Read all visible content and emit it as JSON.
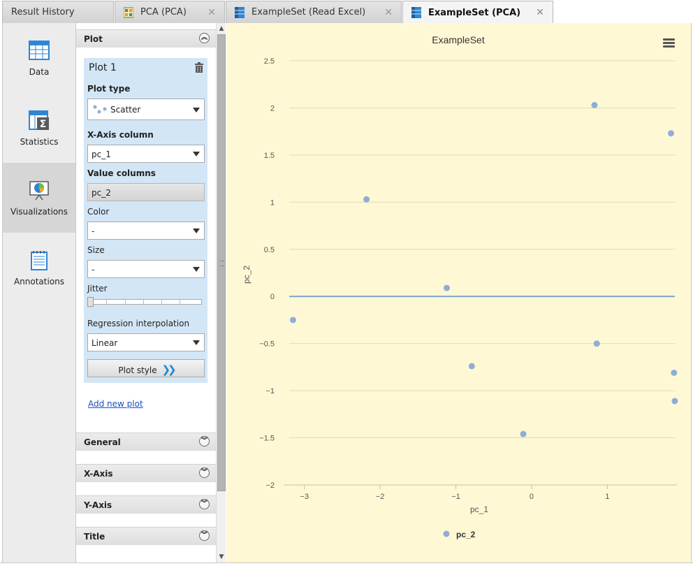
{
  "tabs": [
    {
      "label": "Result History",
      "icon": "",
      "closable": false
    },
    {
      "label": "PCA (PCA)",
      "icon": "pca-model-icon",
      "closable": true
    },
    {
      "label": "ExampleSet (Read Excel)",
      "icon": "exampleset-icon",
      "closable": true
    },
    {
      "label": "ExampleSet (PCA)",
      "icon": "exampleset-icon",
      "closable": true,
      "active": true
    }
  ],
  "close_glyph": "✕",
  "leftnav": {
    "items": [
      {
        "label": "Data",
        "icon": "data-table-icon"
      },
      {
        "label": "Statistics",
        "icon": "statistics-icon"
      },
      {
        "label": "Visualizations",
        "icon": "visualizations-icon",
        "active": true
      },
      {
        "label": "Annotations",
        "icon": "annotations-icon"
      }
    ]
  },
  "config": {
    "plot_section": "Plot",
    "plot": {
      "title": "Plot 1",
      "plot_type_label": "Plot type",
      "plot_type_value": "Scatter",
      "x_axis_label": "X-Axis column",
      "x_axis_value": "pc_1",
      "value_columns_label": "Value columns",
      "value_columns_value": "pc_2",
      "color_label": "Color",
      "color_value": "-",
      "size_label": "Size",
      "size_value": "-",
      "jitter_label": "Jitter",
      "regression_label": "Regression interpolation",
      "regression_value": "Linear",
      "plot_style_button": "Plot style"
    },
    "add_new_plot": "Add new plot",
    "sections": [
      "General",
      "X-Axis",
      "Y-Axis",
      "Title"
    ]
  },
  "colors": {
    "accent": "#1c8ad1",
    "chart_bg": "#fff8d5",
    "point": "#8fadd6",
    "regression": "#7da3cf",
    "plot_panel": "#d3e6f6"
  },
  "chart_data": {
    "type": "scatter",
    "title": "ExampleSet",
    "xlabel": "pc_1",
    "ylabel": "pc_2",
    "xlim": [
      -3.2,
      1.9
    ],
    "ylim": [
      -2,
      2.5
    ],
    "xticks": [
      -3,
      -2,
      -1,
      0,
      1
    ],
    "yticks": [
      -2,
      -1.5,
      -1,
      -0.5,
      0,
      0.5,
      1,
      1.5,
      2,
      2.5
    ],
    "grid": true,
    "legend_position": "bottom",
    "series": [
      {
        "name": "pc_2",
        "points": [
          {
            "x": -3.15,
            "y": -0.25
          },
          {
            "x": -2.18,
            "y": 1.03
          },
          {
            "x": -1.12,
            "y": 0.09
          },
          {
            "x": -0.79,
            "y": -0.74
          },
          {
            "x": -0.11,
            "y": -1.46
          },
          {
            "x": 0.83,
            "y": 2.03
          },
          {
            "x": 0.86,
            "y": -0.5
          },
          {
            "x": 1.84,
            "y": 1.73
          },
          {
            "x": 1.88,
            "y": -0.81
          },
          {
            "x": 1.89,
            "y": -1.11
          }
        ]
      }
    ],
    "regression": {
      "type": "linear",
      "from": [
        -3.2,
        0
      ],
      "to": [
        1.89,
        0
      ]
    }
  }
}
